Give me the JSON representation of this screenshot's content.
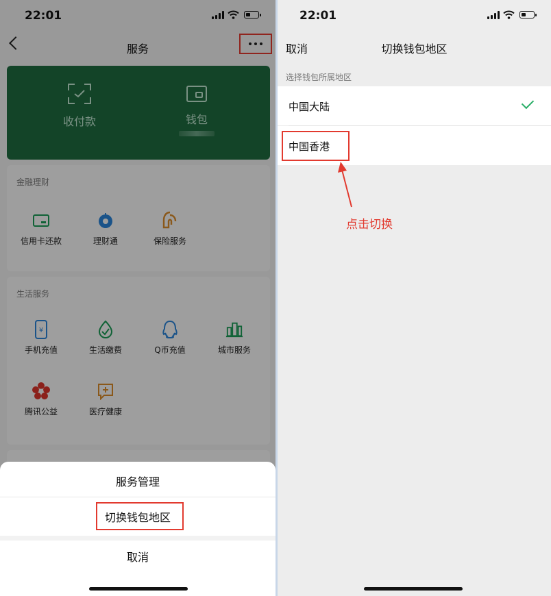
{
  "status": {
    "time": "22:01"
  },
  "left": {
    "nav": {
      "title": "服务"
    },
    "card": {
      "pay_label": "收付款",
      "wallet_label": "钱包"
    },
    "finance": {
      "title": "金融理财",
      "items": [
        {
          "label": "信用卡还款",
          "icon": "credit-card-icon",
          "color": "#1a9a55"
        },
        {
          "label": "理财通",
          "icon": "wealth-icon",
          "color": "#2a83d6"
        },
        {
          "label": "保险服务",
          "icon": "insurance-icon",
          "color": "#d88a2a"
        }
      ]
    },
    "life": {
      "title": "生活服务",
      "items": [
        {
          "label": "手机充值",
          "icon": "phone-icon",
          "color": "#2a83d6"
        },
        {
          "label": "生活缴费",
          "icon": "bill-icon",
          "color": "#1a9a55"
        },
        {
          "label": "Q币充值",
          "icon": "qq-icon",
          "color": "#2a83d6"
        },
        {
          "label": "城市服务",
          "icon": "city-icon",
          "color": "#1a9a55"
        },
        {
          "label": "腾讯公益",
          "icon": "charity-icon",
          "color": "#d9342b"
        },
        {
          "label": "医疗健康",
          "icon": "health-icon",
          "color": "#d88a2a"
        }
      ]
    },
    "sheet": {
      "manage": "服务管理",
      "switch": "切换钱包地区",
      "cancel": "取消"
    }
  },
  "right": {
    "nav": {
      "cancel": "取消",
      "title": "切换钱包地区"
    },
    "caption": "选择钱包所属地区",
    "options": [
      {
        "label": "中国大陆",
        "selected": true
      },
      {
        "label": "中国香港",
        "selected": false
      }
    ],
    "annotation": "点击切换"
  },
  "colors": {
    "accent_green": "#1e6b3f",
    "check_green": "#2aae67",
    "annotation_red": "#e23a2f"
  }
}
